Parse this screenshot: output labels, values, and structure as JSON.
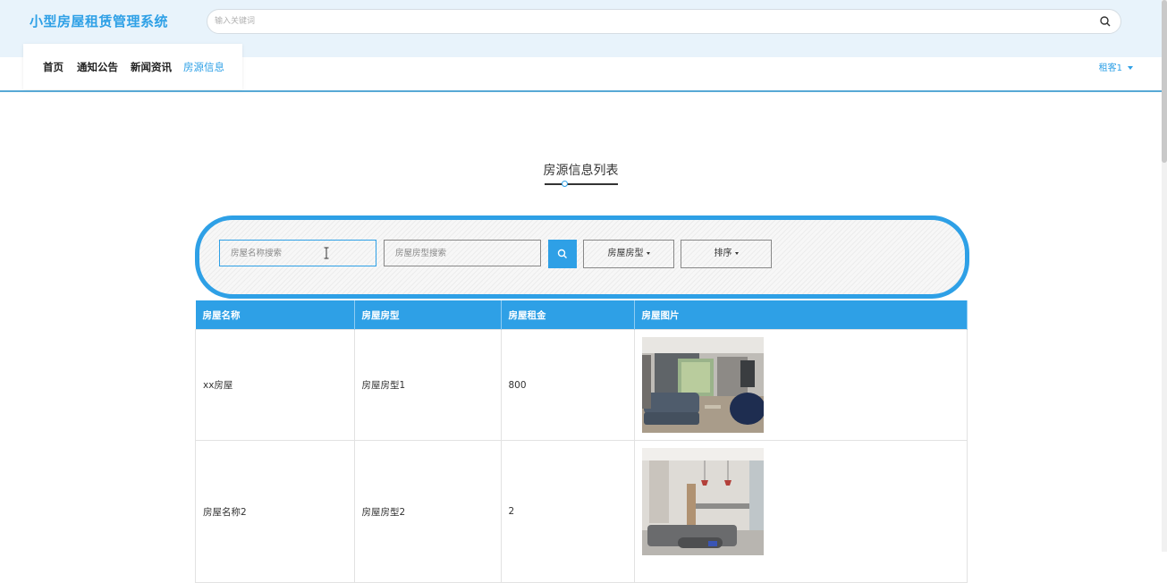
{
  "header": {
    "logo": "小型房屋租赁管理系统",
    "search_placeholder": "输入关键词"
  },
  "nav": {
    "items": [
      {
        "label": "首页"
      },
      {
        "label": "通知公告"
      },
      {
        "label": "新闻资讯"
      },
      {
        "label": "房源信息",
        "active": true
      }
    ],
    "user": "租客1"
  },
  "section": {
    "title": "房源信息列表"
  },
  "filters": {
    "name_placeholder": "房屋名称搜索",
    "type_placeholder": "房屋房型搜索",
    "type_dropdown": "房屋房型",
    "sort_dropdown": "排序"
  },
  "table": {
    "headers": [
      "房屋名称",
      "房屋房型",
      "房屋租金",
      "房屋图片"
    ],
    "rows": [
      {
        "name": "xx房屋",
        "type": "房屋房型1",
        "rent": "800"
      },
      {
        "name": "房屋名称2",
        "type": "房屋房型2",
        "rent": "2"
      }
    ]
  },
  "colors": {
    "accent": "#2ea0e6"
  }
}
